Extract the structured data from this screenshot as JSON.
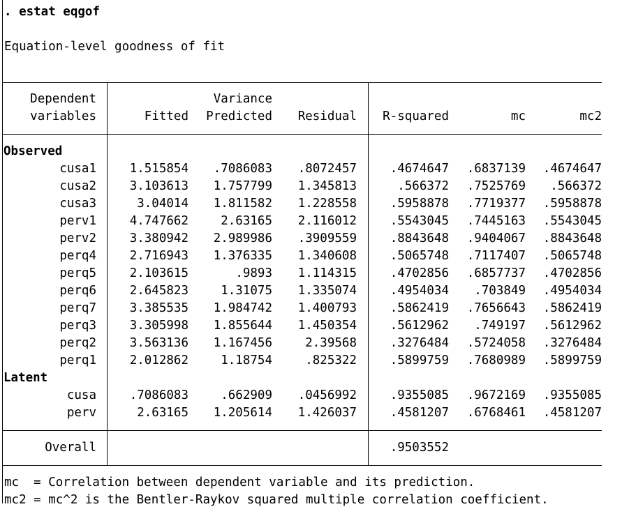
{
  "command": ". estat eqgof",
  "heading": "Equation-level goodness of fit",
  "table": {
    "header": {
      "dep_line1": "Dependent",
      "dep_line2": "variables",
      "variance_label": "Variance",
      "fitted": "Fitted",
      "predicted": "Predicted",
      "residual": "Residual",
      "rsquared": "R-squared",
      "mc": "mc",
      "mc2": "mc2"
    },
    "groups": [
      {
        "label": "Observed",
        "rows": [
          {
            "name": "cusa1",
            "fitted": "1.515854",
            "predicted": ".7086083",
            "residual": ".8072457",
            "rsquared": ".4674647",
            "mc": ".6837139",
            "mc2": ".4674647"
          },
          {
            "name": "cusa2",
            "fitted": "3.103613",
            "predicted": "1.757799",
            "residual": "1.345813",
            "rsquared": ".566372",
            "mc": ".7525769",
            "mc2": ".566372"
          },
          {
            "name": "cusa3",
            "fitted": "3.04014",
            "predicted": "1.811582",
            "residual": "1.228558",
            "rsquared": ".5958878",
            "mc": ".7719377",
            "mc2": ".5958878"
          },
          {
            "name": "perv1",
            "fitted": "4.747662",
            "predicted": "2.63165",
            "residual": "2.116012",
            "rsquared": ".5543045",
            "mc": ".7445163",
            "mc2": ".5543045"
          },
          {
            "name": "perv2",
            "fitted": "3.380942",
            "predicted": "2.989986",
            "residual": ".3909559",
            "rsquared": ".8843648",
            "mc": ".9404067",
            "mc2": ".8843648"
          },
          {
            "name": "perq4",
            "fitted": "2.716943",
            "predicted": "1.376335",
            "residual": "1.340608",
            "rsquared": ".5065748",
            "mc": ".7117407",
            "mc2": ".5065748"
          },
          {
            "name": "perq5",
            "fitted": "2.103615",
            "predicted": ".9893",
            "residual": "1.114315",
            "rsquared": ".4702856",
            "mc": ".6857737",
            "mc2": ".4702856"
          },
          {
            "name": "perq6",
            "fitted": "2.645823",
            "predicted": "1.31075",
            "residual": "1.335074",
            "rsquared": ".4954034",
            "mc": ".703849",
            "mc2": ".4954034"
          },
          {
            "name": "perq7",
            "fitted": "3.385535",
            "predicted": "1.984742",
            "residual": "1.400793",
            "rsquared": ".5862419",
            "mc": ".7656643",
            "mc2": ".5862419"
          },
          {
            "name": "perq3",
            "fitted": "3.305998",
            "predicted": "1.855644",
            "residual": "1.450354",
            "rsquared": ".5612962",
            "mc": ".749197",
            "mc2": ".5612962"
          },
          {
            "name": "perq2",
            "fitted": "3.563136",
            "predicted": "1.167456",
            "residual": "2.39568",
            "rsquared": ".3276484",
            "mc": ".5724058",
            "mc2": ".3276484"
          },
          {
            "name": "perq1",
            "fitted": "2.012862",
            "predicted": "1.18754",
            "residual": ".825322",
            "rsquared": ".5899759",
            "mc": ".7680989",
            "mc2": ".5899759"
          }
        ]
      },
      {
        "label": "Latent",
        "rows": [
          {
            "name": "cusa",
            "fitted": ".7086083",
            "predicted": ".662909",
            "residual": ".0456992",
            "rsquared": ".9355085",
            "mc": ".9672169",
            "mc2": ".9355085"
          },
          {
            "name": "perv",
            "fitted": "2.63165",
            "predicted": "1.205614",
            "residual": "1.426037",
            "rsquared": ".4581207",
            "mc": ".6768461",
            "mc2": ".4581207"
          }
        ]
      }
    ],
    "overall": {
      "label": "Overall",
      "rsquared": ".9503552"
    }
  },
  "notes": [
    "mc  = Correlation between dependent variable and its prediction.",
    "mc2 = mc^2 is the Bentler-Raykov squared multiple correlation coefficient."
  ]
}
